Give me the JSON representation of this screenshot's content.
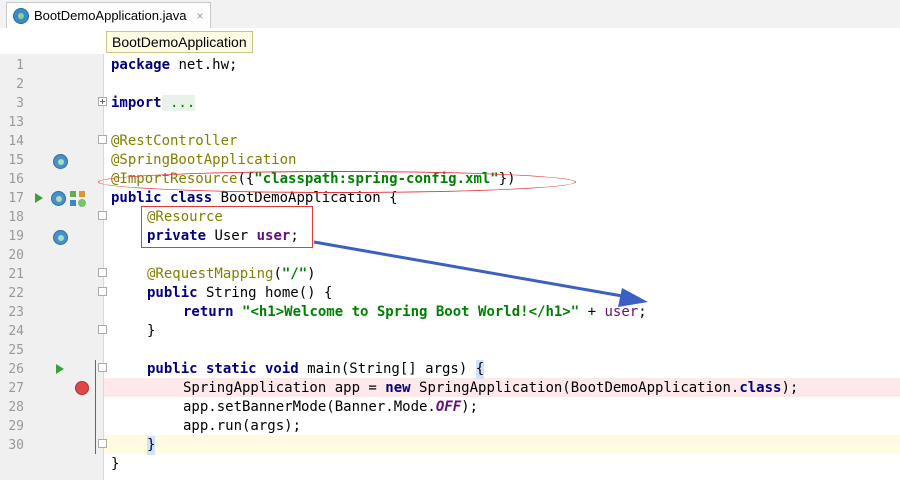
{
  "tab": {
    "title": "BootDemoApplication.java",
    "close": "×"
  },
  "breadcrumb": "BootDemoApplication",
  "lines": [
    {
      "n": "1"
    },
    {
      "n": "2"
    },
    {
      "n": "3"
    },
    {
      "n": "13"
    },
    {
      "n": "14"
    },
    {
      "n": "15"
    },
    {
      "n": "16"
    },
    {
      "n": "17"
    },
    {
      "n": "18"
    },
    {
      "n": "19"
    },
    {
      "n": "20"
    },
    {
      "n": "21"
    },
    {
      "n": "22"
    },
    {
      "n": "23"
    },
    {
      "n": "24"
    },
    {
      "n": "25"
    },
    {
      "n": "26"
    },
    {
      "n": "27"
    },
    {
      "n": "28"
    },
    {
      "n": "29"
    },
    {
      "n": "30"
    }
  ],
  "code": {
    "l1_kw": "package",
    "l1_rest": " net.hw;",
    "l3_kw": "import",
    "l3_rest": " ...",
    "l13": "@RestController",
    "l14": "@SpringBootApplication",
    "l15_ann": "@ImportResource",
    "l15_a": "({",
    "l15_str": "\"classpath:spring-config.xml\"",
    "l15_b": "})",
    "l16_kw": "public class",
    "l16_rest": " BootDemoApplication {",
    "l17": "@Resource",
    "l18_kw": "private",
    "l18_mid": " User ",
    "l18_field": "user",
    "l18_end": ";",
    "l20_ann": "@RequestMapping",
    "l20_a": "(",
    "l20_str": "\"/\"",
    "l20_b": ")",
    "l21_kw": "public",
    "l21_rest": " String home() {",
    "l22_kw": "return",
    "l22_sp": " ",
    "l22_str": "\"<h1>Welcome to Spring Boot World!</h1>\"",
    "l22_plus": " + ",
    "l22_field": "user",
    "l22_end": ";",
    "l23": "}",
    "l25_kw": "public static void",
    "l25_rest": " main(String[] args) ",
    "l25_brace": "{",
    "l26_a": "SpringApplication app = ",
    "l26_kw": "new",
    "l26_b": " SpringApplication(BootDemoApplication.",
    "l26_kw2": "class",
    "l26_c": ");",
    "l27_a": "app.setBannerMode(Banner.Mode.",
    "l27_it": "OFF",
    "l27_b": ");",
    "l28": "app.run(args);",
    "l29": "}",
    "l30": "}"
  },
  "colors": {
    "breakpoint_line": "#fde9e9",
    "current_line": "#fefbe0",
    "annotation": "#e53935",
    "arrow": "#3b5fc4"
  }
}
